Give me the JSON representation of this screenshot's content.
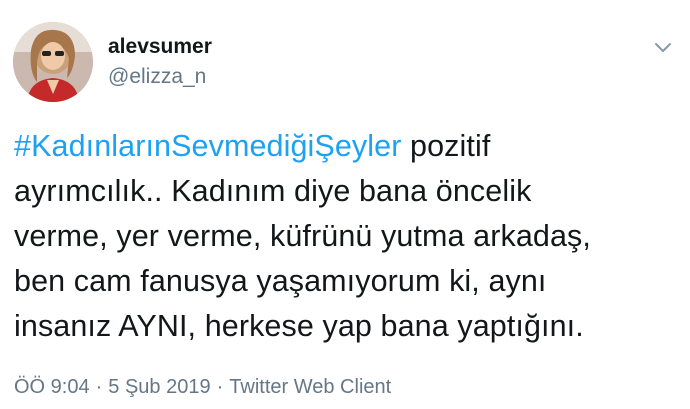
{
  "user": {
    "display_name": "alevsumer",
    "handle": "@elizza_n",
    "avatar_icon": "user-avatar-photo"
  },
  "menu": {
    "icon": "chevron-down-icon"
  },
  "tweet": {
    "hashtag": "#KadınlarınSevmediğiŞeyler",
    "line1_rest": " pozitif",
    "line2": "ayrımcılık.. Kadınım diye bana öncelik",
    "line3": "verme, yer verme, küfrünü yutma arkadaş,",
    "line4": "ben cam fanusya yaşamıyorum ki, aynı",
    "line5": "insanız AYNI, herkese yap bana yaptığını."
  },
  "meta": {
    "time": "ÖÖ 9:04",
    "separator": "·",
    "date": "5 Şub 2019",
    "client": "Twitter Web Client"
  },
  "colors": {
    "hashtag": "#1da1f2",
    "secondary_text": "#657786",
    "primary_text": "#14171a"
  }
}
